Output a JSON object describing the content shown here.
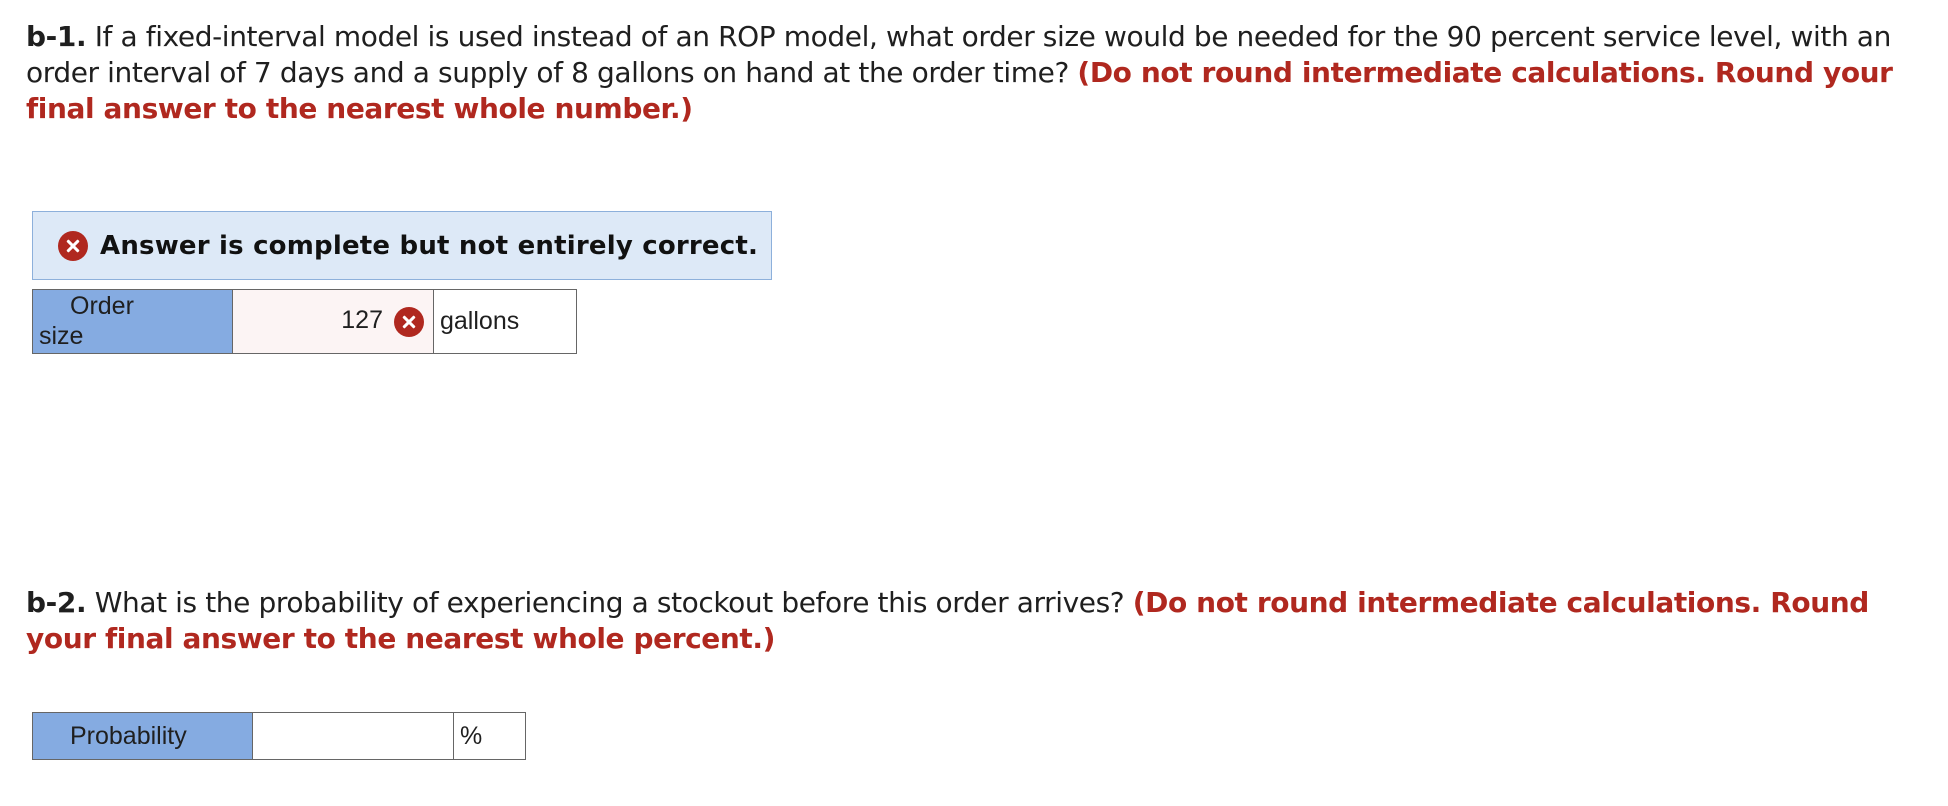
{
  "q1": {
    "number": "b-1.",
    "text": " If a fixed-interval model is used instead of an ROP model, what order size would be needed for the 90 percent service level, with an order interval of 7 days and a supply of 8 gallons on hand at the order time? ",
    "instruction": "(Do not round intermediate calculations. Round your final answer to the nearest whole number.)"
  },
  "feedback": {
    "icon": "x-circle-icon",
    "text": "Answer is complete but not entirely correct.",
    "color": "#b0281f",
    "background": "#dde9f7"
  },
  "answer1": {
    "label_line1": "Order",
    "label_line2": "size",
    "value": "127",
    "status_icon": "x-circle-icon",
    "unit": "gallons"
  },
  "q2": {
    "number": "b-2.",
    "text": " What is the probability of experiencing a stockout before this order arrives? ",
    "instruction": "(Do not round intermediate calculations. Round your final answer to the nearest whole percent.)"
  },
  "answer2": {
    "label": "Probability",
    "value": "",
    "unit": "%"
  },
  "colors": {
    "label_cell": "#85abe1",
    "instruction_red": "#b0281f",
    "incorrect_input_bg": "#fcf4f4"
  }
}
